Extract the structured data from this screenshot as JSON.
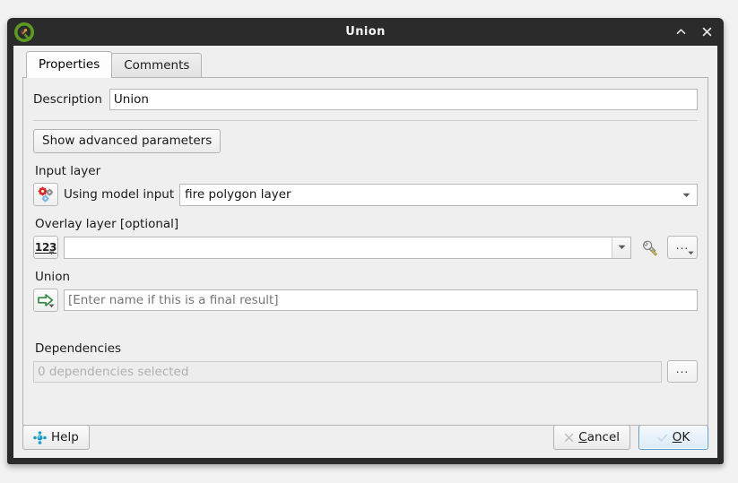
{
  "window": {
    "title": "Union",
    "logo_icon": "qgis-logo-icon",
    "shade_icon": "chevron-up-icon",
    "close_icon": "close-icon"
  },
  "tabs": [
    {
      "label": "Properties",
      "active": true
    },
    {
      "label": "Comments",
      "active": false
    }
  ],
  "form": {
    "description_label": "Description",
    "description_value": "Union",
    "advanced_button": "Show advanced parameters",
    "input_layer": {
      "label": "Input layer",
      "icon": "model-input-gears-icon",
      "prefix_text": "Using model input",
      "value": "fire polygon layer",
      "arrow_icon": "chevron-down-icon"
    },
    "overlay_layer": {
      "label": "Overlay layer [optional]",
      "type_button": "123",
      "type_button_icon": "value-type-123-icon",
      "value": "",
      "arrow_icon": "chevron-down-icon",
      "wrench_icon": "wrench-icon",
      "more_button": "...",
      "more_icon": "ellipsis-dropdown-icon"
    },
    "output": {
      "label": "Union",
      "icon": "green-arrow-output-icon",
      "placeholder": "[Enter name if this is a final result]",
      "value": ""
    },
    "dependencies": {
      "label": "Dependencies",
      "value": "0 dependencies selected",
      "more_button": "..."
    }
  },
  "buttons": {
    "help": "Help",
    "help_icon": "help-icon",
    "cancel_prefix": "",
    "cancel_mnemonic": "C",
    "cancel_rest": "ancel",
    "cancel_icon": "cancel-x-icon",
    "ok_mnemonic": "O",
    "ok_rest": "K",
    "ok_icon": "ok-check-icon"
  },
  "colors": {
    "titlebar": "#2b2b2b",
    "accent": "#5b9bd5",
    "window_bg": "#efefef"
  }
}
